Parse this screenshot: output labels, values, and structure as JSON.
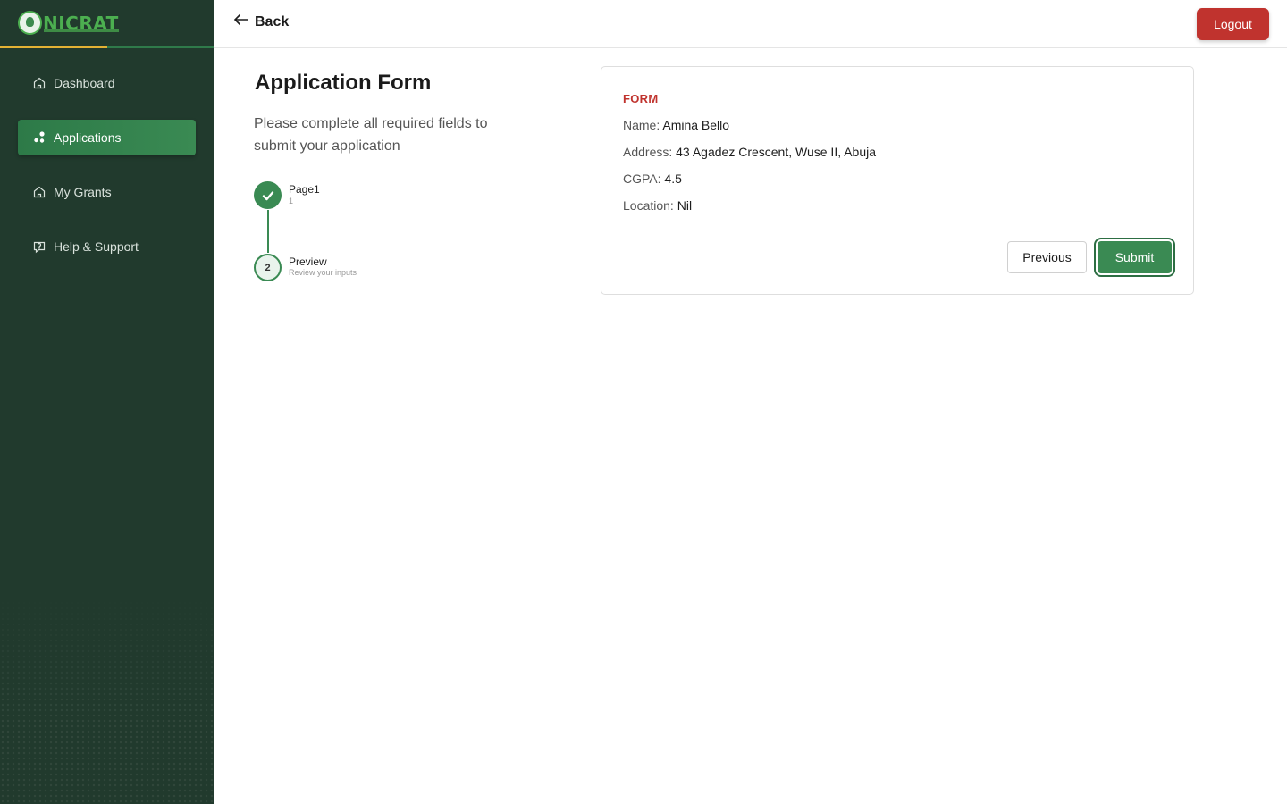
{
  "brand": {
    "name": "NICRAT",
    "colors": {
      "sidebar": "#213a2d",
      "accent": "#3a8a53",
      "danger": "#c0332e",
      "gold": "#e3b234"
    }
  },
  "sidebar": {
    "items": [
      {
        "label": "Dashboard",
        "icon": "home-icon",
        "active": false
      },
      {
        "label": "Applications",
        "icon": "applications-icon",
        "active": true
      },
      {
        "label": "My Grants",
        "icon": "home-icon",
        "active": false
      },
      {
        "label": "Help & Support",
        "icon": "help-icon",
        "active": false
      }
    ]
  },
  "header": {
    "back_label": "Back",
    "logout_label": "Logout"
  },
  "main": {
    "title": "Application Form",
    "description": "Please complete all required fields to submit your application",
    "steps": [
      {
        "number": "1",
        "label": "Page1",
        "sub": "1",
        "status": "done"
      },
      {
        "number": "2",
        "label": "Preview",
        "sub": "Review your inputs",
        "status": "current"
      }
    ]
  },
  "form": {
    "section_label": "FORM",
    "fields": [
      {
        "key": "Name:",
        "value": "Amina Bello"
      },
      {
        "key": "Address:",
        "value": "43 Agadez Crescent, Wuse II, Abuja"
      },
      {
        "key": "CGPA:",
        "value": "4.5"
      },
      {
        "key": "Location:",
        "value": "Nil"
      }
    ],
    "previous_label": "Previous",
    "submit_label": "Submit"
  }
}
